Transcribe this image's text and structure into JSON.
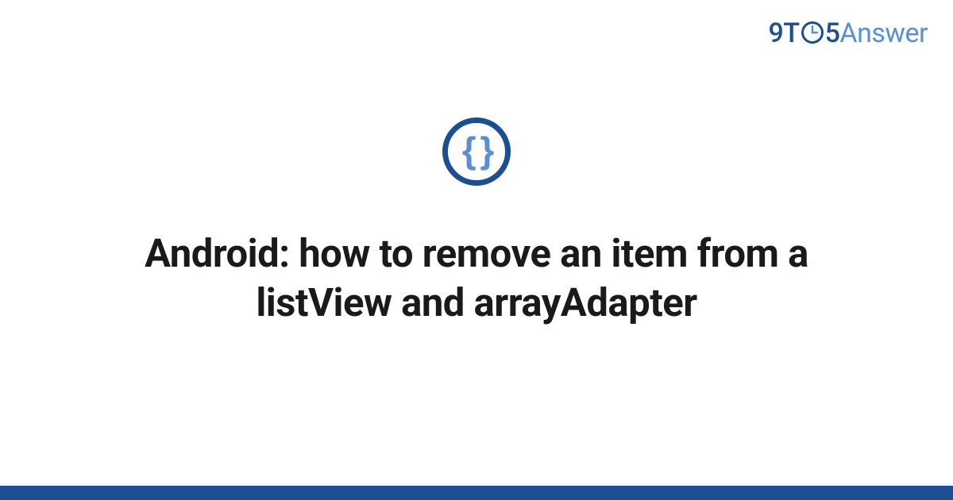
{
  "logo": {
    "part1": "9T",
    "part2": "5",
    "part3": "Answer"
  },
  "icon": {
    "braces": "{ }"
  },
  "title": "Android: how to remove an item from a listView and arrayAdapter",
  "colors": {
    "brand_dark": "#1b4f91",
    "brand_light": "#5a8fd6"
  }
}
